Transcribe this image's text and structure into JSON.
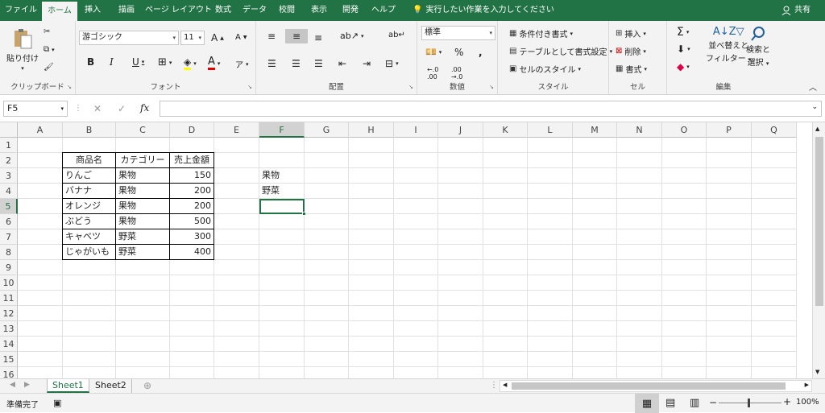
{
  "tabs": [
    "ファイル",
    "ホーム",
    "挿入",
    "描画",
    "ページ レイアウト",
    "数式",
    "データ",
    "校閲",
    "表示",
    "開発",
    "ヘルプ"
  ],
  "active_tab": "ホーム",
  "tell_me": "実行したい作業を入力してください",
  "share": "共有",
  "ribbon": {
    "clipboard": {
      "paste": "貼り付け",
      "label": "クリップボード"
    },
    "font": {
      "name": "游ゴシック",
      "size": "11",
      "label": "フォント"
    },
    "alignment": {
      "label": "配置"
    },
    "number": {
      "format": "標準",
      "label": "数値"
    },
    "styles": {
      "cond": "条件付き書式",
      "table": "テーブルとして書式設定",
      "cell": "セルのスタイル",
      "label": "スタイル"
    },
    "cells": {
      "insert": "挿入",
      "delete": "削除",
      "format": "書式",
      "label": "セル"
    },
    "editing": {
      "sort": "並べ替えと",
      "sort2": "フィルター",
      "find": "検索と",
      "find2": "選択",
      "label": "編集"
    }
  },
  "name_box": "F5",
  "formula": "",
  "columns": [
    "A",
    "B",
    "C",
    "D",
    "E",
    "F",
    "G",
    "H",
    "I",
    "J",
    "K",
    "L",
    "M",
    "N",
    "O",
    "P",
    "Q"
  ],
  "rows": [
    "1",
    "2",
    "3",
    "4",
    "5",
    "6",
    "7",
    "8",
    "9",
    "10",
    "11",
    "12",
    "13",
    "14",
    "15",
    "16"
  ],
  "cells": {
    "B2": "商品名",
    "C2": "カテゴリー",
    "D2": "売上金額",
    "B3": "りんご",
    "C3": "果物",
    "D3": "150",
    "B4": "バナナ",
    "C4": "果物",
    "D4": "200",
    "B5": "オレンジ",
    "C5": "果物",
    "D5": "200",
    "B6": "ぶどう",
    "C6": "果物",
    "D6": "500",
    "B7": "キャベツ",
    "C7": "野菜",
    "D7": "300",
    "B8": "じゃがいも",
    "C8": "野菜",
    "D8": "400",
    "F3": "果物",
    "F4": "野菜"
  },
  "sheets": [
    "Sheet1",
    "Sheet2"
  ],
  "active_sheet": "Sheet1",
  "status": "準備完了",
  "zoom": "100%",
  "colors": {
    "accent": "#217346"
  }
}
